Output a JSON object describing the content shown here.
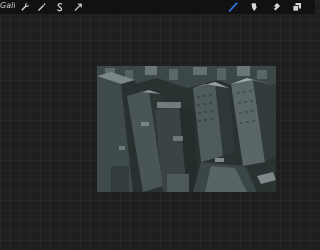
{
  "toolbar": {
    "gallery_label": "Galleri",
    "left_tools": [
      {
        "name": "wrench-icon"
      },
      {
        "name": "magic-wand-icon"
      },
      {
        "name": "selection-icon"
      },
      {
        "name": "transform-arrow-icon"
      }
    ],
    "right_tools": [
      {
        "name": "brush-icon",
        "active": true
      },
      {
        "name": "smudge-icon"
      },
      {
        "name": "eraser-icon"
      },
      {
        "name": "layers-icon"
      }
    ],
    "active_color": "#2f6fdc"
  },
  "canvas": {
    "subject": "city-skyline-artwork",
    "palette": {
      "dark": "#2a3131",
      "mid": "#465252",
      "light": "#6c7878",
      "highlight": "#8c9696"
    }
  }
}
